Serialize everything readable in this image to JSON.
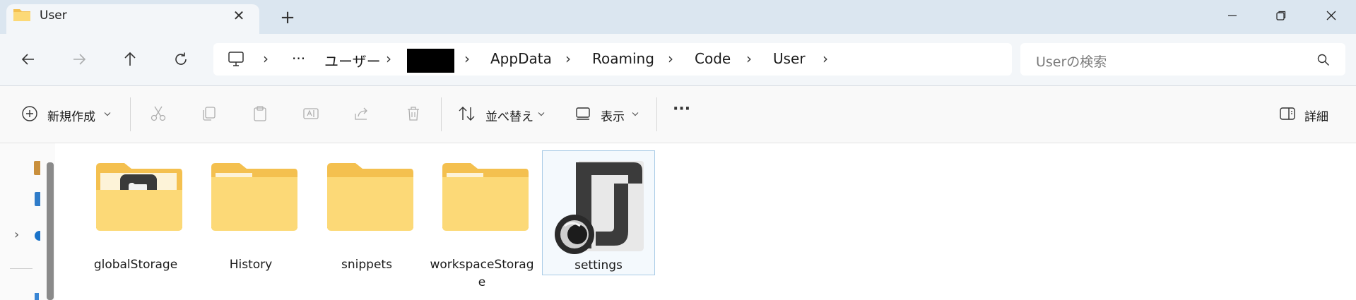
{
  "window": {
    "tab_title": "User",
    "new_tab_label": "+"
  },
  "address": {
    "crumbs": [
      "ユーザー",
      "AppData",
      "Roaming",
      "Code",
      "User"
    ],
    "ellipsis": "···"
  },
  "search": {
    "placeholder": "Userの検索"
  },
  "toolbar": {
    "new_label": "新規作成",
    "sort_label": "並べ替え",
    "view_label": "表示",
    "more_label": "···",
    "details_label": "詳細"
  },
  "items": [
    {
      "name": "globalStorage",
      "type": "folder-with-file"
    },
    {
      "name": "History",
      "type": "folder"
    },
    {
      "name": "snippets",
      "type": "folder"
    },
    {
      "name": "workspaceStorag\ne",
      "type": "folder"
    },
    {
      "name": "settings",
      "type": "json-file"
    }
  ],
  "colors": {
    "titlebar": "#dbe6f0",
    "folder_back": "#f4c04f",
    "folder_front": "#fcd977",
    "selection_border": "#a9cbe6"
  }
}
